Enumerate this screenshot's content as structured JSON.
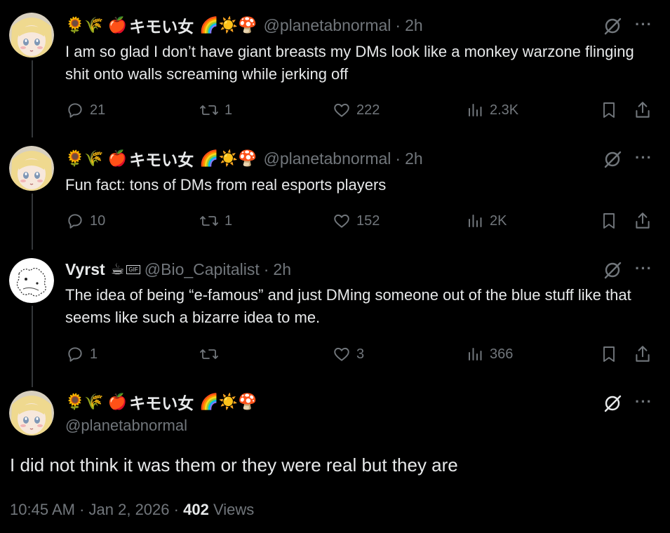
{
  "tweets": [
    {
      "display_emojis_pre": "🌻🌾 🍎",
      "display_name": "キモい女",
      "display_emojis_post": "🌈☀️🍄",
      "handle": "@planetabnormal",
      "time": "2h",
      "text": "I am so glad I don’t have giant breasts my DMs look like a monkey warzone flinging shit onto walls screaming while jerking off",
      "replies": "21",
      "reposts": "1",
      "likes": "222",
      "views": "2.3K"
    },
    {
      "display_emojis_pre": "🌻🌾 🍎",
      "display_name": "キモい女",
      "display_emojis_post": "🌈☀️🍄",
      "handle": "@planetabnormal",
      "time": "2h",
      "text": "Fun fact: tons of DMs from real esports players",
      "replies": "10",
      "reposts": "1",
      "likes": "152",
      "views": "2K"
    },
    {
      "display_name": "Vyrst",
      "display_emojis_post": "☕",
      "badge_text": "GIF",
      "handle": "@Bio_Capitalist",
      "time": "2h",
      "text": "The idea of being “e-famous” and just DMing someone out of the blue stuff like that seems like such a bizarre idea to me.",
      "replies": "1",
      "reposts": "",
      "likes": "3",
      "views": "366"
    }
  ],
  "focused": {
    "display_emojis_pre": "🌻🌾 🍎",
    "display_name": "キモい女",
    "display_emojis_post": "🌈☀️🍄",
    "handle": "@planetabnormal",
    "text": "I did not think it was them or they were real but they are",
    "time": "10:45 AM",
    "date": "Jan 2, 2026",
    "views_count": "402",
    "views_label": "Views"
  },
  "icons": {
    "grok": "grok-icon",
    "more": "more-icon",
    "reply": "reply-icon",
    "repost": "repost-icon",
    "like": "like-icon",
    "views": "views-icon",
    "bookmark": "bookmark-icon",
    "share": "share-icon"
  },
  "colors": {
    "background": "#000000",
    "text_primary": "#e7e9ea",
    "text_secondary": "#71767b",
    "thread_line": "#333639"
  }
}
